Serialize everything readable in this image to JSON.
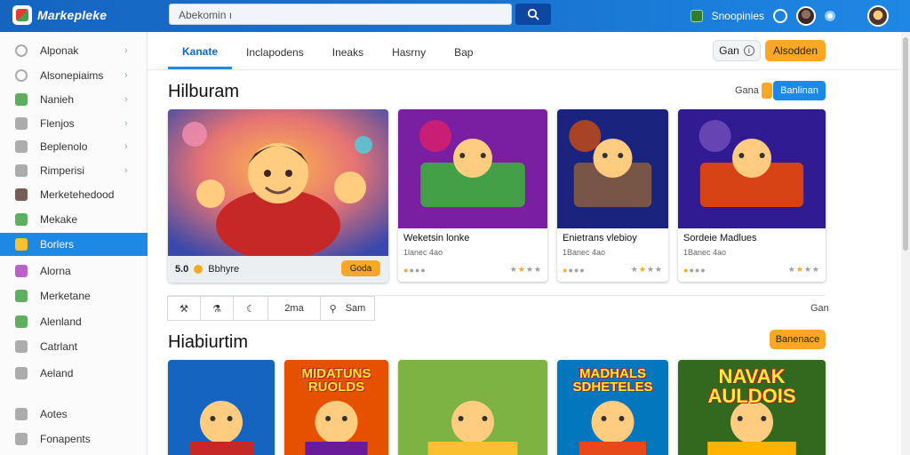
{
  "header": {
    "brand": "Markepleke",
    "search_value": "Abekomin ı",
    "user_label": "Snoopinies"
  },
  "sidebar": {
    "items": [
      {
        "label": "Alponak",
        "icon": "search-icon",
        "color": "#9e9e9e",
        "chevron": true
      },
      {
        "label": "Alsonepiaims",
        "icon": "search-icon",
        "color": "#9e9e9e",
        "chevron": true
      },
      {
        "label": "Nanieh",
        "icon": "game-icon",
        "color": "#43a047",
        "chevron": true
      },
      {
        "label": "Flenjos",
        "icon": "mail-icon",
        "color": "#9e9e9e",
        "chevron": true
      },
      {
        "label": "Beplenolo",
        "icon": "grid-icon",
        "color": "#9e9e9e",
        "chevron": true
      },
      {
        "label": "Rimperisi",
        "icon": "puzzle-icon",
        "color": "#9e9e9e",
        "chevron": true
      },
      {
        "label": "Merketehedood",
        "icon": "store-icon",
        "color": "#5d4037",
        "chevron": false
      },
      {
        "label": "Mekake",
        "icon": "leaf-icon",
        "color": "#43a047",
        "chevron": false
      },
      {
        "label": "Borlers",
        "icon": "folder-icon",
        "color": "#fbc02d",
        "chevron": false
      },
      {
        "label": "Alorna",
        "icon": "apps-icon",
        "color": "#ab47bc",
        "chevron": false
      },
      {
        "label": "Merketane",
        "icon": "tag-icon",
        "color": "#43a047",
        "chevron": false
      },
      {
        "label": "Alenland",
        "icon": "calendar-icon",
        "color": "#43a047",
        "chevron": false
      },
      {
        "label": "Catrlant",
        "icon": "doc-icon",
        "color": "#9e9e9e",
        "chevron": false
      },
      {
        "label": "Aeland",
        "icon": "list-icon",
        "color": "#9e9e9e",
        "chevron": false
      },
      {
        "label": "Aotes",
        "icon": "note-icon",
        "color": "#9e9e9e",
        "chevron": false
      },
      {
        "label": "Fonapents",
        "icon": "cart-icon",
        "color": "#9e9e9e",
        "chevron": false
      }
    ],
    "active_index": 8
  },
  "tabs": [
    "Kanate",
    "Inclapodens",
    "Ineaks",
    "Hasrny",
    "Bap"
  ],
  "toolbar_actions": {
    "ghost_label": "Gan",
    "primary_label": "Alsodden"
  },
  "section1": {
    "title": "Hilburam",
    "side_label": "Gana",
    "badge": "Banlinan",
    "featured": {
      "caption": "Bbhyre",
      "rating": "5.0",
      "action": "Goda"
    },
    "cards": [
      {
        "title": "Weketsin lonke",
        "sub": "1lanec 4ao"
      },
      {
        "title": "Enietrans vlebioy",
        "sub": "1Banec 4ao"
      },
      {
        "title": "Sordeie Madlues",
        "sub": "1Banec 4ao"
      }
    ]
  },
  "filters": {
    "items": [
      "wrench-icon",
      "flask-icon",
      "moon-icon",
      "2ma",
      "Sam"
    ],
    "right_label": "Gan"
  },
  "section2": {
    "title": "Hiabiurtim",
    "button": "Banenace",
    "cards": [
      {
        "title": "",
        "art": "hero"
      },
      {
        "title": "MIDATUNS RUOLDS",
        "art": "knight"
      },
      {
        "title": "",
        "art": "dog"
      },
      {
        "title": "MADHALS SDHETELES",
        "art": "hero2"
      },
      {
        "title": "NAVAK AULDOIS",
        "art": "beast"
      }
    ]
  },
  "colors": {
    "brand": "#1976d2",
    "accent": "#f9a825",
    "active": "#1e88e5"
  }
}
